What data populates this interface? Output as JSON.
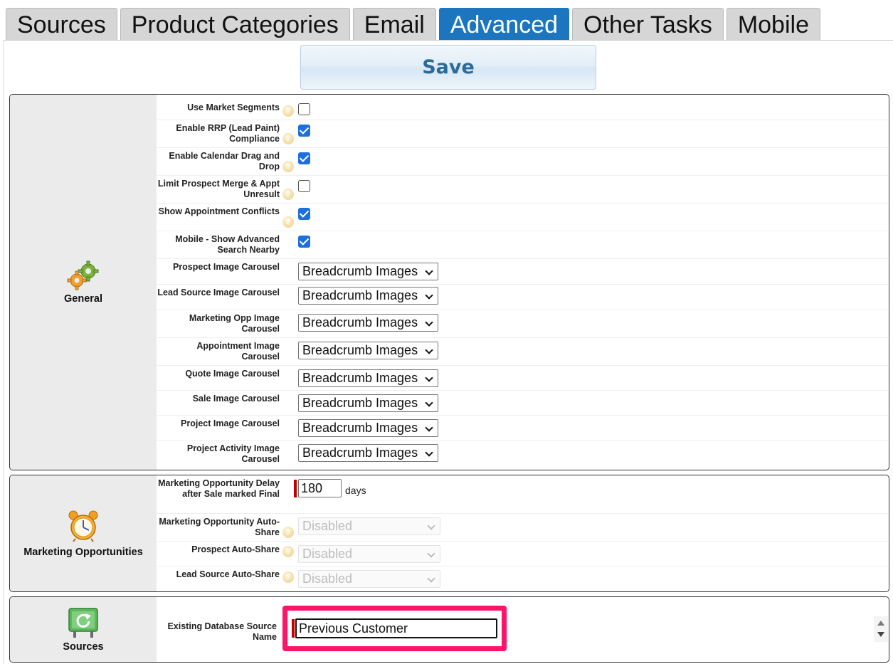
{
  "tabs": [
    {
      "label": "Sources"
    },
    {
      "label": "Product Categories"
    },
    {
      "label": "Email"
    },
    {
      "label": "Advanced",
      "active": true
    },
    {
      "label": "Other Tasks"
    },
    {
      "label": "Mobile"
    }
  ],
  "save_label": "Save",
  "general": {
    "title": "General",
    "icon": "gears-icon",
    "checkbox_rows": [
      {
        "label": "Use Market Segments",
        "checked": false,
        "help": true
      },
      {
        "label": "Enable RRP (Lead Paint) Compliance",
        "checked": true,
        "help": true
      },
      {
        "label": "Enable Calendar Drag and Drop",
        "checked": true,
        "help": true
      },
      {
        "label": "Limit Prospect Merge & Appt Unresult",
        "checked": false,
        "help": true
      },
      {
        "label": "Show Appointment Conflicts",
        "checked": true,
        "help": true
      },
      {
        "label": "Mobile - Show Advanced Search Nearby",
        "checked": true,
        "help": false
      }
    ],
    "select_rows": [
      {
        "label": "Prospect Image Carousel",
        "value": "Breadcrumb Images"
      },
      {
        "label": "Lead Source Image Carousel",
        "value": "Breadcrumb Images"
      },
      {
        "label": "Marketing Opp Image Carousel",
        "value": "Breadcrumb Images"
      },
      {
        "label": "Appointment Image Carousel",
        "value": "Breadcrumb Images"
      },
      {
        "label": "Quote Image Carousel",
        "value": "Breadcrumb Images"
      },
      {
        "label": "Sale Image Carousel",
        "value": "Breadcrumb Images"
      },
      {
        "label": "Project Image Carousel",
        "value": "Breadcrumb Images"
      },
      {
        "label": "Project Activity Image Carousel",
        "value": "Breadcrumb Images"
      }
    ]
  },
  "marketing": {
    "title": "Marketing Opportunities",
    "icon": "alarm-clock-icon",
    "delay_label": "Marketing Opportunity Delay after Sale marked Final",
    "delay_value": "180",
    "delay_unit": "days",
    "auto_share_label": "Marketing Opportunity Auto-Share",
    "auto_share_value": "Disabled",
    "prospect_share_label": "Prospect Auto-Share",
    "prospect_share_value": "Disabled",
    "lead_share_label": "Lead Source Auto-Share",
    "lead_share_value": "Disabled"
  },
  "sources": {
    "title": "Sources",
    "icon": "refresh-sign-icon",
    "field_label": "Existing Database Source Name",
    "field_value": "Previous Customer"
  },
  "colors": {
    "accent": "#1b76bf",
    "highlight": "#ff1468",
    "required": "#c20000"
  }
}
